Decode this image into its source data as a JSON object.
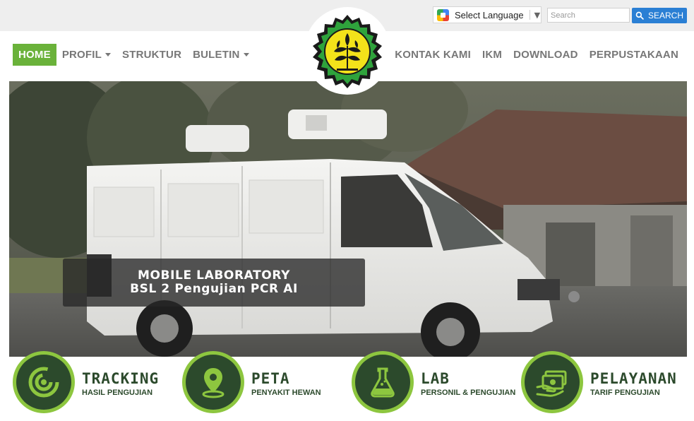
{
  "topbar": {
    "language_label": "Select Language",
    "language_arrow": "▼",
    "search_placeholder": "Search",
    "search_button": "SEARCH"
  },
  "nav": {
    "left": [
      {
        "label": "HOME",
        "active": true,
        "dropdown": false
      },
      {
        "label": "PROFIL",
        "active": false,
        "dropdown": true
      },
      {
        "label": "STRUKTUR",
        "active": false,
        "dropdown": false
      },
      {
        "label": "BULETIN",
        "active": false,
        "dropdown": true
      }
    ],
    "right": [
      {
        "label": "KONTAK KAMI"
      },
      {
        "label": "IKM"
      },
      {
        "label": "DOWNLOAD"
      },
      {
        "label": "PERPUSTAKAAN"
      }
    ]
  },
  "hero": {
    "caption_line1": "MOBILE LABORATORY",
    "caption_line2": "BSL 2 Pengujian PCR AI"
  },
  "features": [
    {
      "title": "TRACKING",
      "subtitle": "HASIL PENGUJIAN",
      "icon": "radar-icon"
    },
    {
      "title": "PETA",
      "subtitle": "PENYAKIT HEWAN",
      "icon": "map-pin-icon"
    },
    {
      "title": "LAB",
      "subtitle": "PERSONIL & PENGUJIAN",
      "icon": "flask-icon"
    },
    {
      "title": "PELAYANAN",
      "subtitle": "TARIF PENGUJIAN",
      "icon": "money-icon"
    }
  ],
  "colors": {
    "brand_green": "#6ab23a",
    "feature_ring": "#8dc63f",
    "feature_dark": "#2c4a2c",
    "search_blue": "#2a7fd4"
  }
}
